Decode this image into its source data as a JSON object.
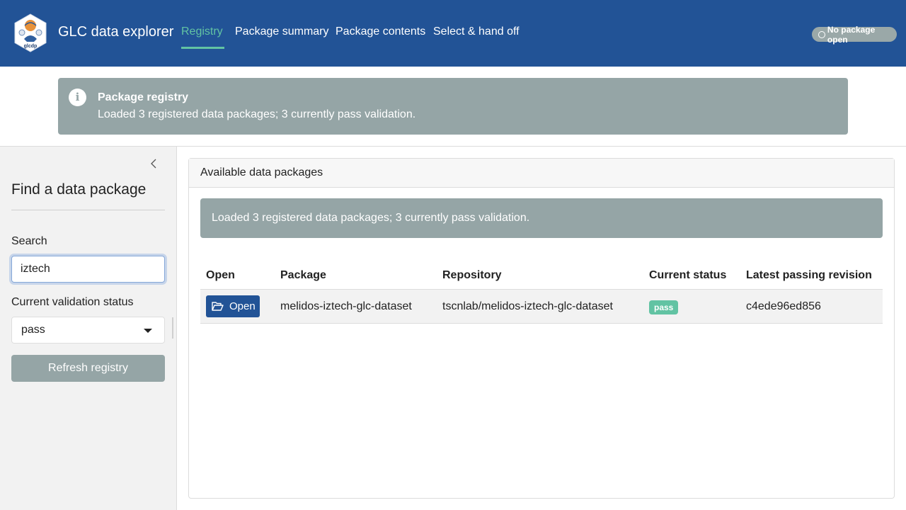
{
  "navbar": {
    "logo_text": "glcdp",
    "title": "GLC data explorer",
    "links": [
      {
        "label": "Registry",
        "active": true
      },
      {
        "label": "Package summary",
        "active": false
      },
      {
        "label": "Package contents",
        "active": false
      },
      {
        "label": "Select & hand off",
        "active": false
      }
    ],
    "package_status": "No package open",
    "background_color": "#225396",
    "active_color": "#62c3a3"
  },
  "top_alert": {
    "icon": "info-icon",
    "heading": "Package registry",
    "message": "Loaded 3 registered data packages; 3 currently pass validation."
  },
  "sidebar": {
    "title": "Find a data package",
    "search": {
      "label": "Search",
      "value": "iztech"
    },
    "status_filter": {
      "label": "Current validation status",
      "selected": "pass"
    },
    "refresh_label": "Refresh registry"
  },
  "main": {
    "card_title": "Available data packages",
    "alert": "Loaded 3 registered data packages; 3 currently pass validation.",
    "table": {
      "columns": [
        "Open",
        "Package",
        "Repository",
        "Current status",
        "Latest passing revision"
      ],
      "rows": [
        {
          "open_label": "Open",
          "package": "melidos-iztech-glc-dataset",
          "repository": "tscnlab/melidos-iztech-glc-dataset",
          "status": "pass",
          "revision": "c4ede96ed856"
        }
      ]
    }
  }
}
